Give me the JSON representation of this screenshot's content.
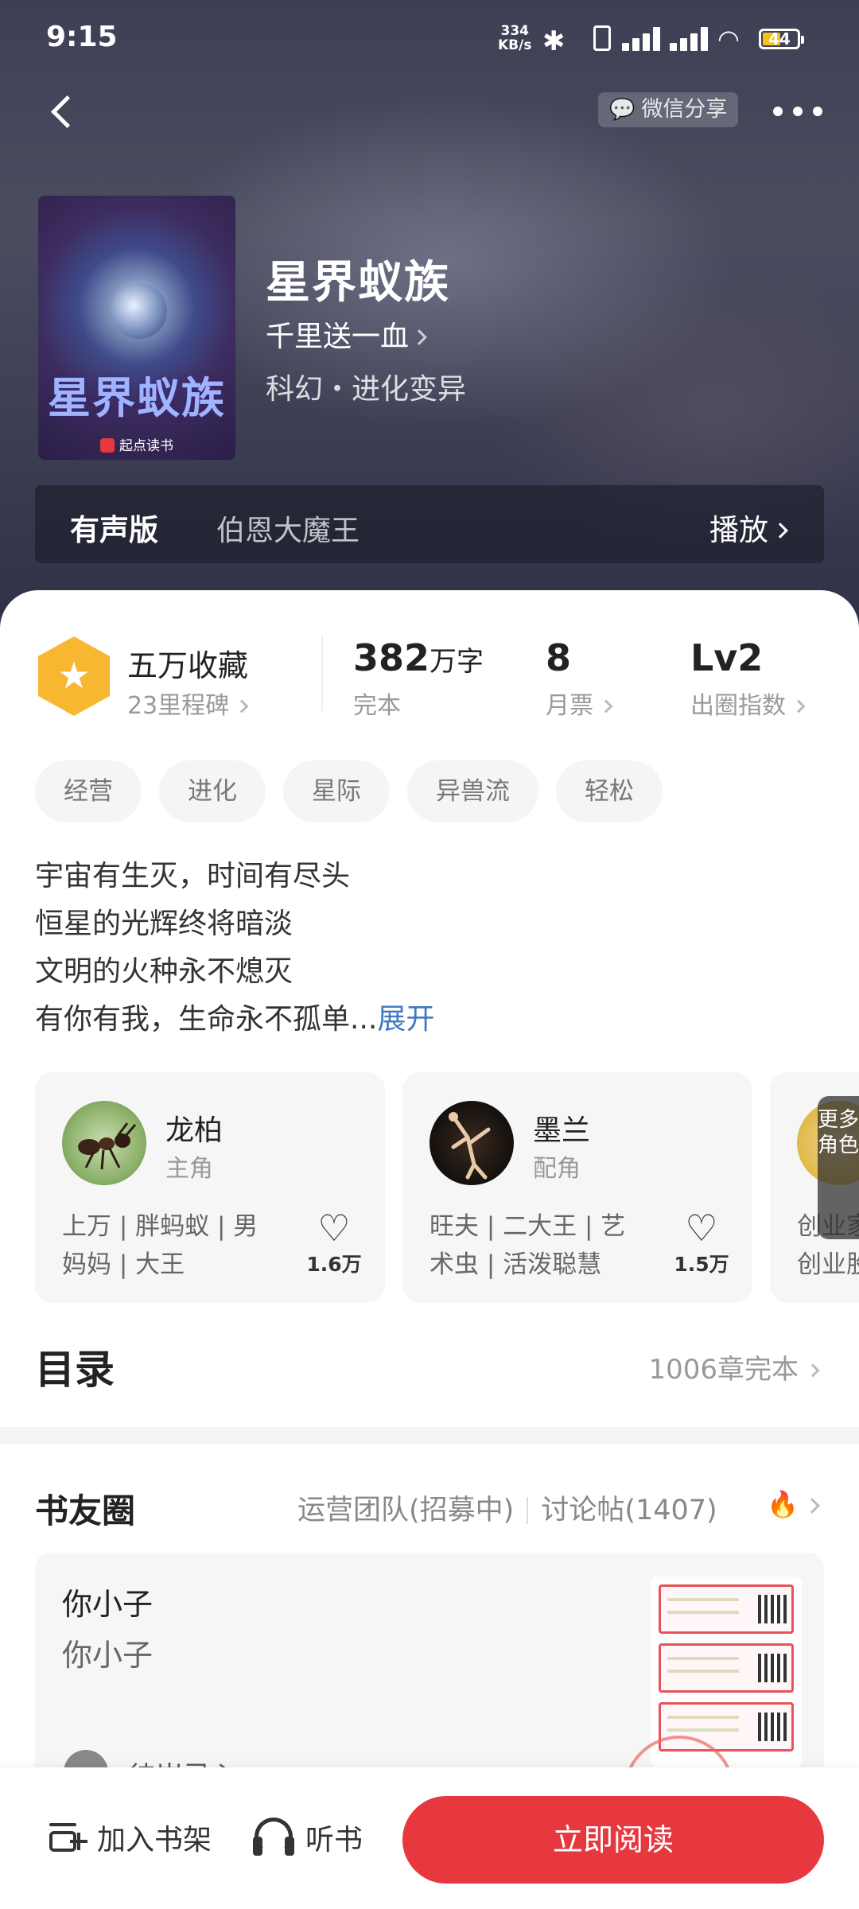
{
  "status_bar": {
    "time": "9:15",
    "net_speed_value": "334",
    "net_speed_unit": "KB/s",
    "battery": "44",
    "battery_color": "#f3c21b"
  },
  "header": {
    "back_icon": "chevron-left-icon",
    "share_label": "微信分享",
    "share_icon": "wechat-icon",
    "more_icon": "more-dots-icon"
  },
  "book": {
    "title": "星界蚁族",
    "author": "千里送一血",
    "genre": "科幻・进化变异",
    "cover_title": "星界蚁族",
    "cover_publisher": "起点读书"
  },
  "audio": {
    "label": "有声版",
    "narrator": "伯恩大魔王",
    "play_label": "播放"
  },
  "stats": {
    "collect": "五万收藏",
    "milestones": "23里程碑",
    "word_count": "382",
    "word_unit": "万字",
    "status": "完本",
    "monthly_tickets": "8",
    "monthly_label": "月票",
    "level": "Lv2",
    "level_label": "出圈指数"
  },
  "tags": [
    "经营",
    "进化",
    "星际",
    "异兽流",
    "轻松"
  ],
  "description": {
    "lines": [
      "宇宙有生灭，时间有尽头",
      "恒星的光辉终将暗淡",
      "文明的火种永不熄灭"
    ],
    "last_line": "有你有我，生命永不孤单...",
    "expand": "展开"
  },
  "characters": [
    {
      "name": "龙柏",
      "role": "主角",
      "traits_line1": "上万 | 胖蚂蚁 | 男",
      "traits_line2": "妈妈 | 大王",
      "likes": "1.6万"
    },
    {
      "name": "墨兰",
      "role": "配角",
      "traits_line1": "旺夫 | 二大王 | 艺",
      "traits_line2": "术虫 | 活泼聪慧",
      "likes": "1.5万"
    },
    {
      "traits_line1": "创业家",
      "traits_line2": "创业股"
    }
  ],
  "more_roles": "更多角色",
  "toc": {
    "title": "目录",
    "info": "1006章完本"
  },
  "circle": {
    "title": "书友圈",
    "ops_team": "运营团队(招募中)",
    "discussion": "讨论帖(1407)",
    "post_title": "你小子",
    "post_body": "你小子",
    "post_user": "徒岸灵心"
  },
  "bottom": {
    "shelf": "加入书架",
    "listen": "听书",
    "read": "立即阅读",
    "accent": "#e7373f"
  }
}
